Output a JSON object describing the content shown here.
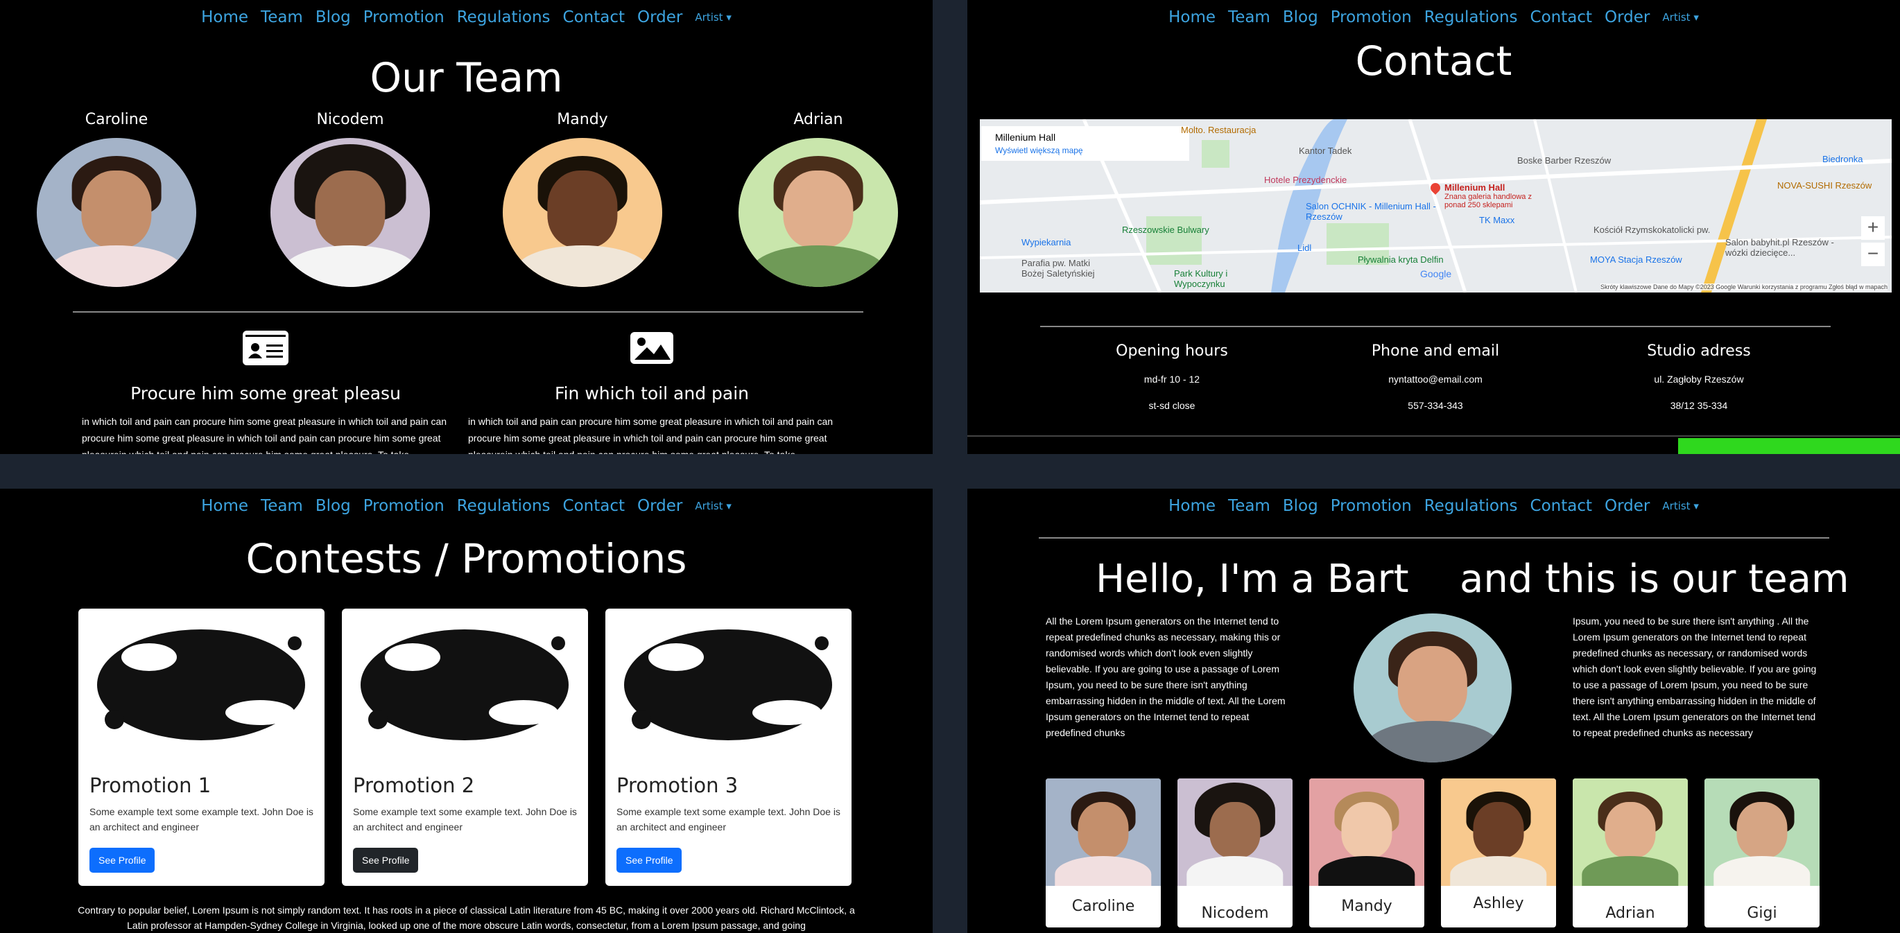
{
  "nav": {
    "links": [
      "Home",
      "Team",
      "Blog",
      "Promotion",
      "Regulations",
      "Contact",
      "Order"
    ],
    "dropdown": "Artist ▾"
  },
  "team_page": {
    "title": "Our Team",
    "members": [
      "Caroline",
      "Nicodem",
      "Mandy",
      "Adrian"
    ],
    "features": [
      {
        "icon": "id-card-icon",
        "title": "Procure him some great pleasu",
        "text": "in which toil and pain can procure him some great pleasure in which toil and pain can procure him some great pleasure in which toil and pain can procure him some great pleasurein which toil and pain can procure him some great pleasure. To take"
      },
      {
        "icon": "image-icon",
        "title": "Fin which toil and pain",
        "text": "in which toil and pain can procure him some great pleasure in which toil and pain can procure him some great pleasure in which toil and pain can procure him some great pleasurein which toil and pain can procure him some great pleasure. To take"
      }
    ]
  },
  "contact_page": {
    "title": "Contact",
    "map": {
      "place": "Millenium Hall",
      "link": "Wyświetl większą mapę",
      "labels": [
        "Molto. Restauracja",
        "Kantor Tadek",
        "Boske Barber Rzeszów",
        "Hotele Prezydenckie",
        "Millenium Hall",
        "Znana galeria handlowa z ponad 250 sklepami",
        "Salon OCHNIK - Millenium Hall - Rzeszów",
        "TK Maxx",
        "NOVA-SUSHI Rzeszów",
        "Biedronka",
        "Rzeszowskie Bulwary",
        "Wypiekarnia",
        "Lidl",
        "Pływalnia kryta Delfin",
        "Park Kultury i Wypoczynku",
        "Parafia pw. Matki Bożej Saletyńskiej",
        "MOYA Stacja Rzeszów",
        "Kościół Rzymskokatolicki pw.",
        "Salon babyhit.pl Rzeszów - wózki dziecięce...",
        "Google"
      ],
      "footer": "Skróty klawiszowe   Dane do Mapy ©2023 Google   Warunki korzystania z programu   Zgłoś błąd w mapach",
      "zoom_in": "+",
      "zoom_out": "−"
    },
    "columns": [
      {
        "head": "Opening hours",
        "lines": [
          "md-fr 10 - 12",
          "st-sd close"
        ]
      },
      {
        "head": "Phone and email",
        "lines": [
          "nyntattoo@email.com",
          "557-334-343"
        ]
      },
      {
        "head": "Studio adress",
        "lines": [
          "ul. Zagłoby Rzeszów",
          "38/12 35-334"
        ]
      }
    ],
    "accent_color": "#2fd81e"
  },
  "promo_page": {
    "title": "Contests / Promotions",
    "cards": [
      {
        "title": "Promotion 1",
        "text": "Some example text some example text. John Doe is an architect and engineer",
        "button": "See Profile",
        "button_color": "#0d6efd"
      },
      {
        "title": "Promotion 2",
        "text": "Some example text some example text. John Doe is an architect and engineer",
        "button": "See Profile",
        "button_color": "#212529"
      },
      {
        "title": "Promotion 3",
        "text": "Some example text some example text. John Doe is an architect and engineer",
        "button": "See Profile",
        "button_color": "#0d6efd"
      }
    ],
    "footer": "Contrary to popular belief, Lorem Ipsum is not simply random text. It has roots in a piece of classical Latin literature from 45 BC, making it over 2000 years old. Richard McClintock, a Latin professor at Hampden-Sydney College in Virginia, looked up one of the more obscure Latin words, consectetur, from a Lorem Ipsum passage, and going"
  },
  "bart_page": {
    "title_left": "Hello, I'm a Bart",
    "title_right": "and this is our team",
    "text_left": "All the Lorem Ipsum generators on the Internet tend to repeat predefined chunks as necessary, making this or randomised words which don't look even slightly believable. If you are going to use a passage of Lorem Ipsum, you need to be sure there isn't anything embarrassing hidden in the middle of text. All the Lorem Ipsum generators on the Internet tend to repeat predefined chunks",
    "text_right": "Ipsum, you need to be sure there isn't anything . All the Lorem Ipsum generators on the Internet tend to repeat predefined chunks as necessary, or randomised words which don't look even slightly believable. If you are going to use a passage of Lorem Ipsum, you need to be sure there isn't anything embarrassing hidden in the middle of text. All the Lorem Ipsum generators on the Internet tend to repeat predefined chunks as necessary",
    "team": [
      "Caroline",
      "Nicodem",
      "Mandy",
      "Ashley",
      "Adrian",
      "Gigi"
    ]
  }
}
